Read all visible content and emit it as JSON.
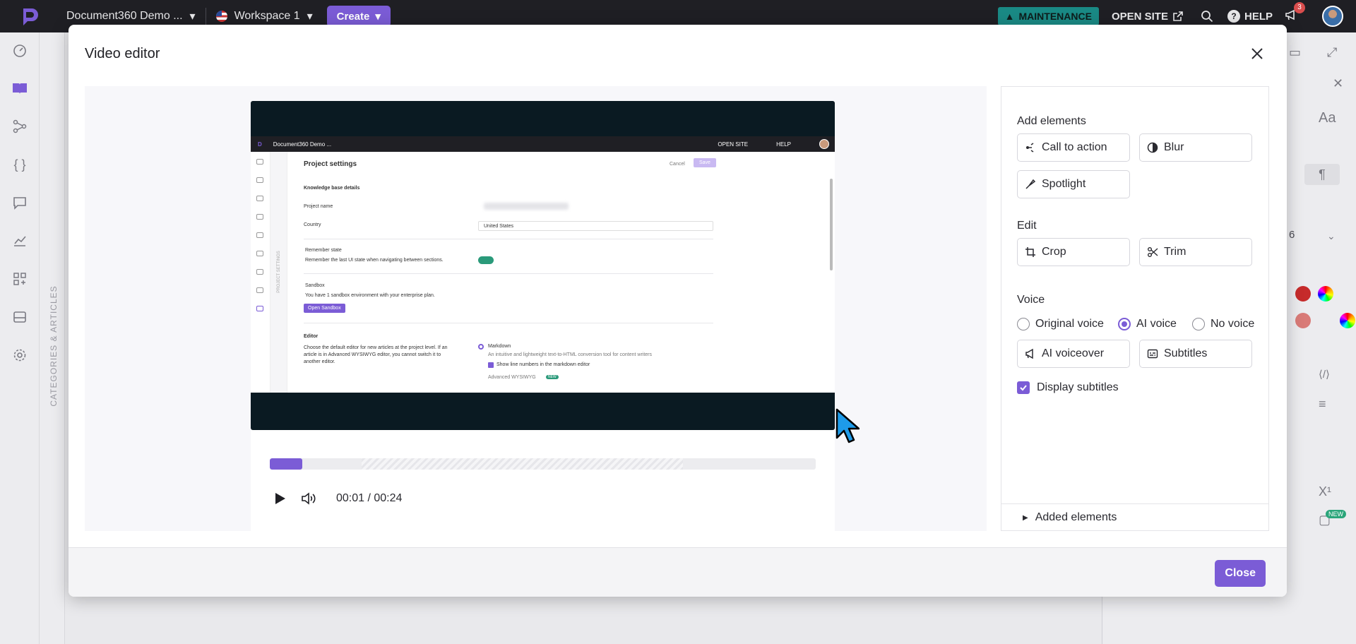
{
  "topbar": {
    "project": "Document360 Demo ...",
    "workspace": "Workspace 1",
    "create": "Create",
    "maintenance": "MAINTENANCE",
    "open_site": "OPEN SITE",
    "help": "HELP",
    "notifications": "3"
  },
  "background": {
    "categories_label": "CATEGORIES & ARTICLES",
    "right_panel_number": "6",
    "new_badge": "NEW"
  },
  "modal": {
    "title": "Video editor",
    "close_button": "Close"
  },
  "player": {
    "time": "00:01 / 00:24",
    "progress_fraction": 0.06
  },
  "video_frame": {
    "project": "Document360 Demo ...",
    "open_site": "OPEN SITE",
    "help": "HELP",
    "page_title": "Project settings",
    "cancel": "Cancel",
    "save": "Save",
    "vertical_label": "PROJECT SETTINGS",
    "section_kb": "Knowledge base details",
    "project_name_label": "Project name",
    "country_label": "Country",
    "country_value": "United States",
    "remember_title": "Remember state",
    "remember_desc": "Remember the last UI state when navigating between sections.",
    "sandbox_title": "Sandbox",
    "sandbox_desc": "You have 1 sandbox environment with your enterprise plan.",
    "open_sandbox": "Open Sandbox",
    "editor_title": "Editor",
    "editor_desc_1": "Choose the default editor for new articles at the project level. If an",
    "editor_desc_2": "article is in Advanced WYSIWYG editor, you cannot switch it to",
    "editor_desc_3": "another editor.",
    "markdown": "Markdown",
    "markdown_desc": "An intuitive and lightweight text-to-HTML conversion tool for content writers",
    "line_numbers": "Show line numbers in the markdown editor",
    "advanced": "Advanced WYSIWYG",
    "new": "NEW"
  },
  "panel": {
    "add_elements": "Add elements",
    "call_to_action": "Call to action",
    "blur": "Blur",
    "spotlight": "Spotlight",
    "edit": "Edit",
    "crop": "Crop",
    "trim": "Trim",
    "voice": "Voice",
    "voice_options": [
      "Original voice",
      "AI voice",
      "No voice"
    ],
    "selected_voice": "AI voice",
    "ai_voiceover": "AI voiceover",
    "subtitles": "Subtitles",
    "display_subtitles": "Display subtitles",
    "display_subtitles_checked": true,
    "added_elements": "Added elements"
  }
}
